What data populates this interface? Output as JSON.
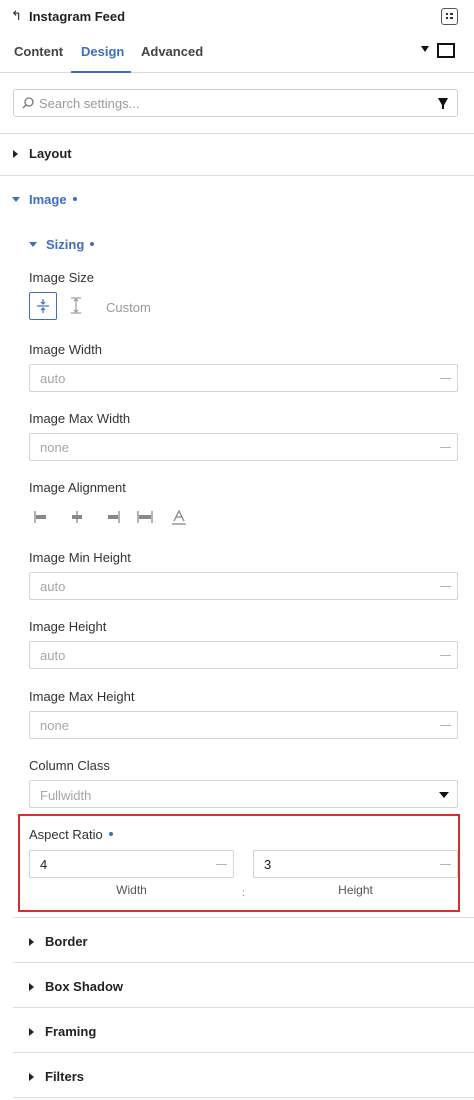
{
  "header": {
    "back_icon": "back-arrow-icon",
    "title": "Instagram Feed",
    "collapse_icon": "panel-collapse-icon"
  },
  "tabs": [
    {
      "label": "Content",
      "active": false
    },
    {
      "label": "Design",
      "active": true
    },
    {
      "label": "Advanced",
      "active": false
    }
  ],
  "device": {
    "icon": "desktop-icon"
  },
  "search": {
    "placeholder": "Search settings...",
    "value": ""
  },
  "accent_color": "#3f6ec0",
  "highlight_color": "#d32f2f",
  "sections": {
    "layout": {
      "label": "Layout",
      "expanded": false
    },
    "image": {
      "label": "Image",
      "expanded": true,
      "modified": true
    },
    "sizing": {
      "label": "Sizing",
      "expanded": true,
      "modified": true
    }
  },
  "fields": {
    "image_size": {
      "label": "Image Size",
      "options": [
        "fit-icon",
        "height-icon"
      ],
      "custom_label": "Custom",
      "selected": 0
    },
    "image_width": {
      "label": "Image Width",
      "placeholder": "auto"
    },
    "image_max_width": {
      "label": "Image Max Width",
      "placeholder": "none"
    },
    "image_alignment": {
      "label": "Image Alignment",
      "icons": [
        "align-left-icon",
        "align-center-icon",
        "align-right-icon",
        "align-justify-icon",
        "text-icon"
      ]
    },
    "image_min_height": {
      "label": "Image Min Height",
      "placeholder": "auto"
    },
    "image_height": {
      "label": "Image Height",
      "placeholder": "auto"
    },
    "image_max_height": {
      "label": "Image Max Height",
      "placeholder": "none"
    },
    "column_class": {
      "label": "Column Class",
      "value": "Fullwidth"
    },
    "aspect_ratio": {
      "label": "Aspect Ratio",
      "modified": true,
      "width_value": "4",
      "height_value": "3",
      "width_label": "Width",
      "height_label": "Height",
      "separator": ":"
    }
  },
  "subsections": [
    {
      "label": "Border"
    },
    {
      "label": "Box Shadow"
    },
    {
      "label": "Framing"
    },
    {
      "label": "Filters"
    }
  ]
}
